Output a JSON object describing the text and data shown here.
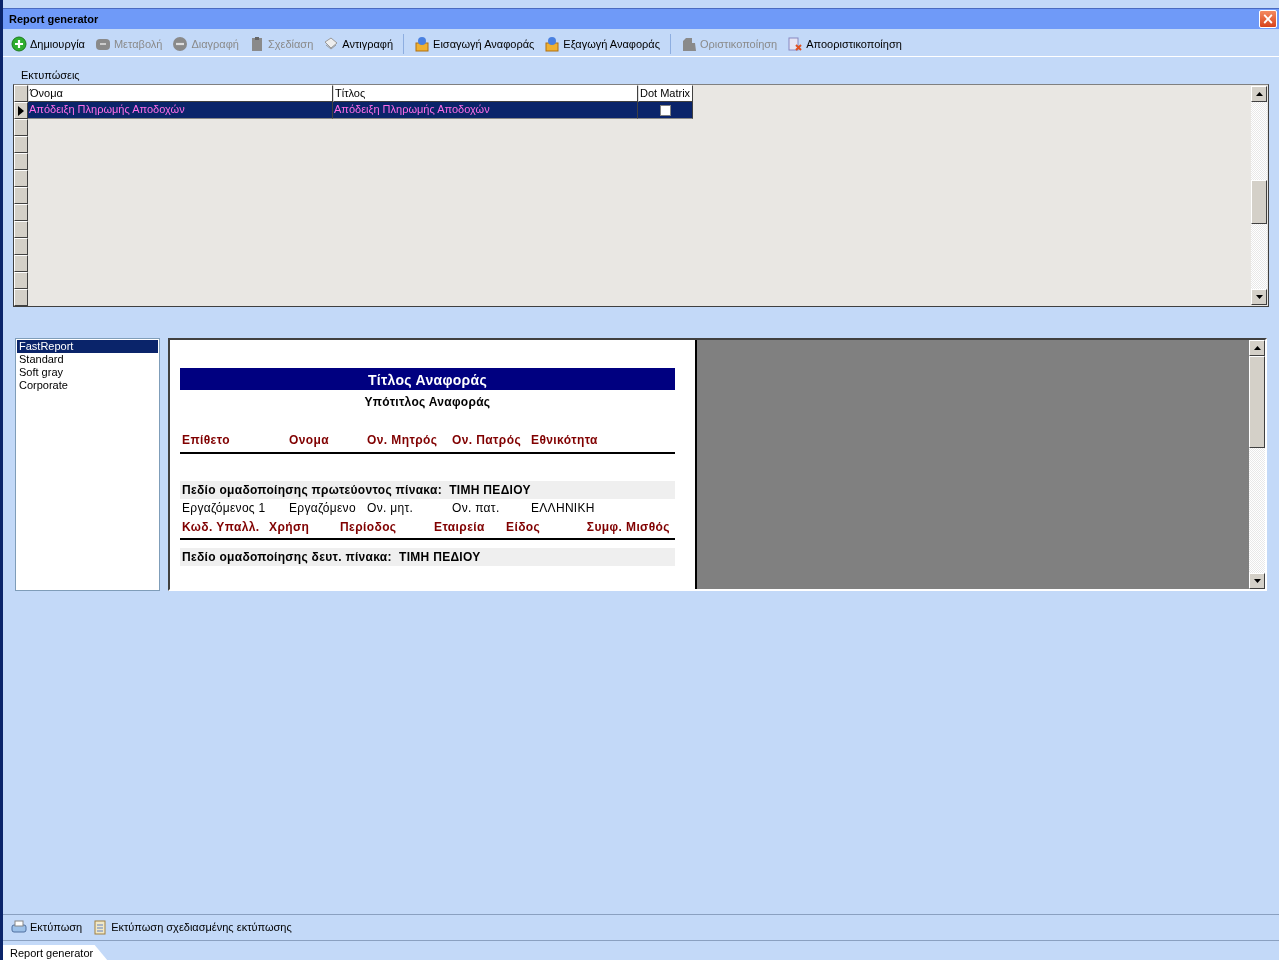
{
  "window": {
    "title": "Report generator",
    "close": "×"
  },
  "toolbar": [
    {
      "kind": "add",
      "label": "Δημιουργία",
      "disabled": false
    },
    {
      "kind": "edit",
      "label": "Μεταβολή",
      "disabled": true
    },
    {
      "kind": "delete",
      "label": "Διαγραφή",
      "disabled": true
    },
    {
      "kind": "design",
      "label": "Σχεδίαση",
      "disabled": true
    },
    {
      "kind": "copy",
      "label": "Αντιγραφή",
      "disabled": false,
      "separator_after": true
    },
    {
      "kind": "import",
      "label": "Εισαγωγή Αναφοράς",
      "disabled": false
    },
    {
      "kind": "export",
      "label": "Εξαγωγή Αναφοράς",
      "disabled": false,
      "separator_after": true
    },
    {
      "kind": "finalize",
      "label": "Οριστικοποίηση",
      "disabled": true
    },
    {
      "kind": "unfinalize",
      "label": "Αποοριστικοποίηση",
      "disabled": false
    }
  ],
  "prints": {
    "label": "Εκτυπώσεις",
    "columns": [
      "Όνομα",
      "Τίτλος",
      "Dot Matrix"
    ],
    "rows": [
      {
        "name": "Απόδειξη Πληρωμής Αποδοχών",
        "title": "Απόδειξη Πληρωμής Αποδοχών",
        "dot_matrix": false,
        "selected": true
      }
    ]
  },
  "templates": [
    {
      "label": "FastReport",
      "selected": true
    },
    {
      "label": "Standard",
      "selected": false
    },
    {
      "label": "Soft gray",
      "selected": false
    },
    {
      "label": "Corporate",
      "selected": false
    }
  ],
  "preview": {
    "title": "Τίτλος Αναφοράς",
    "subtitle": "Υπότιτλος Αναφοράς",
    "header": [
      "Επίθετο",
      "Ονομα",
      "Ον. Μητρός",
      "Ον. Πατρός",
      "Εθνικότητα"
    ],
    "group1": {
      "label": "Πεδίο ομαδοποίησης πρωτεύοντος πίνακα:",
      "value": "ΤΙΜΗ ΠΕΔΙΟΥ"
    },
    "row": [
      "Εργαζόμενος 1",
      "Εργαζόμενο",
      "Ον. μητ.",
      "Ον. πατ.",
      "ΕΛΛΗΝΙΚΗ"
    ],
    "detail_header": [
      "Κωδ. Υπαλλ.",
      "Χρήση",
      "Περίοδος",
      "Εταιρεία",
      "Είδος",
      "Συμφ. Μισθός"
    ],
    "group2": {
      "label": "Πεδίο ομαδοποίησης δευτ. πίνακα:",
      "value": "ΤΙΜΗ ΠΕΔΙΟΥ"
    }
  },
  "bottom_toolbar": [
    {
      "kind": "print",
      "label": "Εκτύπωση"
    },
    {
      "kind": "print-designed",
      "label": "Εκτύπωση σχεδιασμένης εκτύπωσης"
    }
  ],
  "tabs": [
    {
      "label": "Report generator",
      "selected": true
    }
  ]
}
